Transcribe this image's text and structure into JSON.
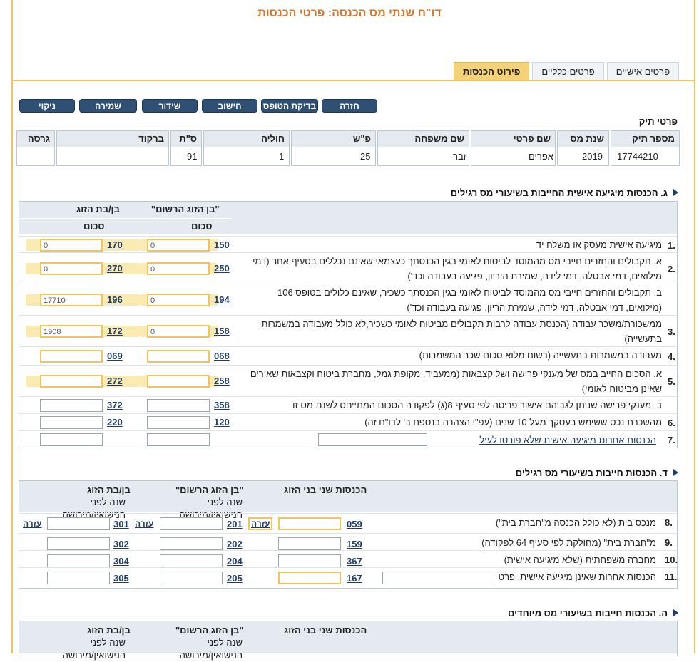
{
  "page": {
    "title": "דו\"ח שנתי מס הכנסה: פרטי הכנסות"
  },
  "tabs": [
    {
      "label": "פרטים אישיים"
    },
    {
      "label": "פרטים כלליים"
    },
    {
      "label": "פירוט הכנסות"
    }
  ],
  "buttons": {
    "back": "חזרה",
    "form_check": "בדיקת הטופס",
    "calc": "חישוב",
    "broadcast": "שידור",
    "save": "שמירה",
    "clear": "ניקוי"
  },
  "file": {
    "heading": "פרטי תיק",
    "cols": {
      "file_no": "מספר תיק",
      "tax_year": "שנת מס",
      "first_name": "שם פרטי",
      "last_name": "שם משפחה",
      "ps": "פ\"ש",
      "cholia": "חוליה",
      "st": "ס\"ת",
      "barcode": "ברקוד",
      "version": "גרסה"
    },
    "values": {
      "file_no": "17744210",
      "tax_year": "2019",
      "first_name": "אפרים",
      "last_name": "זבר",
      "ps": "25",
      "cholia": "1",
      "st": "91"
    }
  },
  "g": {
    "title": "ג. הכנסות מיגיעה אישית החייבות בשיעורי מס רגילים",
    "h_reg": "\"בן הזוג הרשום\"",
    "h_spouse": "בן/בת הזוג",
    "h_sum": "סכום",
    "rows": [
      {
        "n": "1.",
        "t": "מיגיעה אישית מעסק או משלח יד",
        "c1": "150",
        "v1": "0",
        "c2": "170",
        "v2": "0"
      },
      {
        "n": "2.",
        "t": "א. תקבולים והחזרים חייבי מס מהמוסד לביטוח לאומי בגין הכנסתך כעצמאי שאינם נכללים בסעיף אחר (דמי מילואים, דמי אבטלה, דמי לידה, שמירת היריון, פגיעה בעבודה וכד')",
        "c1": "250",
        "v1": "0",
        "c2": "270",
        "v2": "0"
      },
      {
        "n": "",
        "t": "ב. תקבולים והחזרים חייבי מס מהמוסד לביטוח לאומי בגין הכנסתך כשכיר, שאינם כלולים בטופס 106 (מילואים, דמי אבטלה, דמי לידה, שמירת הריון, פגיעה בעבודה וכד')",
        "c1": "194",
        "v1": "0",
        "c2": "196",
        "v2": "17710"
      },
      {
        "n": "3.",
        "t": "ממשכורת/משכר עבודה (הכנסת עבודה לרבות תקבולים מביטוח לאומי כשכיר,לא כולל מעבודה במשמרות בתעשייה)",
        "c1": "158",
        "v1": "0",
        "c2": "172",
        "v2": "1908"
      },
      {
        "n": "4.",
        "t": "מעבודה במשמרות בתעשייה (רשום מלוא סכום שכר המשמרות)",
        "c1": "068",
        "v1": "",
        "c2": "069",
        "v2": ""
      },
      {
        "n": "5.",
        "t": "א. הסכום החייב במס של מענקי פרישה ושל קצבאות (ממעביד, מקופת גמל, מחברת ביטוח וקצבאות שאירים שאינן מביטוח לאומי)",
        "c1": "258",
        "v1": "",
        "c2": "272",
        "v2": ""
      },
      {
        "n": "",
        "t": "ב. מענקי פרישה שניתן לגביהם אישור פריסה לפי סעיף 8(ג) לפקודה הסכום המתייחס לשנת מס זו",
        "c1": "358",
        "v1": "",
        "c2": "372",
        "v2": ""
      },
      {
        "n": "6.",
        "t": "מהשכרת נכס ששימש בעסקך מעל 10 שנים (עפ\"י הצהרה בנספח ב' לדו\"ח זה)",
        "c1": "120",
        "v1": "",
        "c2": "220",
        "v2": ""
      },
      {
        "n": "7.",
        "t": "הכנסות אחרות מיגיעה אישית שלא פורטו לעיל",
        "c1": "",
        "v1": "",
        "c2": "",
        "v2": ""
      }
    ]
  },
  "d": {
    "title": "ד. הכנסות חייבות בשיעורי מס רגילים",
    "h_both": "הכנסות שני בני הזוג",
    "h_reg": "\"בן הזוג הרשום\"",
    "h_spouse": "בן/בת הזוג",
    "h_sub": "שנה לפני הנישואין/מירושה",
    "help": "עזרה",
    "rows": [
      {
        "n": "8.",
        "t": "מנכס בית (לא כולל הכנסה מ\"חברת בית\")",
        "c0": "059",
        "c1": "201",
        "c2": "301"
      },
      {
        "n": "9.",
        "t": "מ\"חברת בית\" (מחולקת לפי סעיף 64 לפקודה)",
        "c0": "159",
        "c1": "202",
        "c2": "302"
      },
      {
        "n": "10.",
        "t": "מחברה משפחתית (שלא מיגיעה אישית)",
        "c0": "367",
        "c1": "204",
        "c2": "304"
      },
      {
        "n": "11.",
        "t": "הכנסות אחרות שאינן מיגיעה אישית. פרט",
        "c0": "167",
        "c1": "205",
        "c2": "305"
      }
    ]
  },
  "h": {
    "title": "ה. הכנסות חייבות בשיעורי מס מיוחדים",
    "h_both": "הכנסות שני בני הזוג",
    "h_reg": "\"בן הזוג הרשום\"",
    "h_spouse": "בן/בת הזוג",
    "h_sub": "שנה לפני הנישואין/מירושה"
  }
}
